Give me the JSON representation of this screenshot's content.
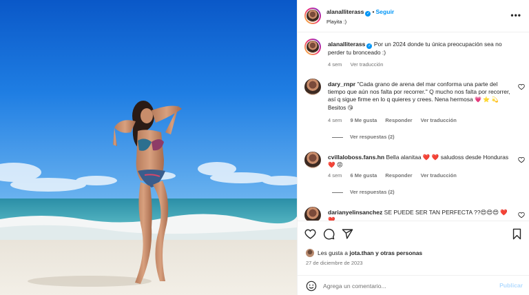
{
  "post": {
    "author": "alanalliterass",
    "location": "Playita :)",
    "follow_label": "Seguir",
    "caption_text": "Por un 2024 donde tu única preocupación sea no perder tu bronceado :)",
    "caption_age": "4 sem",
    "caption_translate": "Ver traducción"
  },
  "comments": [
    {
      "user": "dary_rnpr",
      "text": "\"Cada grano de arena del mar conforma una parte del tiempo que aún nos falta por recorrer.\" Q mucho nos falta por recorrer, así q sigue firme en lo q quieres y crees. Nena hermosa",
      "emoji_tail": "💗 ⭐ 💫 Besitos 😘",
      "age": "4 sem",
      "likes": "9 Me gusta",
      "reply": "Responder",
      "translate": "Ver traducción",
      "replies": "Ver respuestas (2)"
    },
    {
      "user": "cvillaloboss.fans.hn",
      "text": "Bella alanitaa ❤️ ❤️ saludoss desde Honduras ❤️ 😡",
      "age": "4 sem",
      "likes": "6 Me gusta",
      "reply": "Responder",
      "translate": "Ver traducción",
      "replies": "Ver respuestas (2)"
    },
    {
      "user": "darianyelinsanchez",
      "text": "SE PUEDE SER TAN PERFECTA ??😍😍😍 ❤️❤️"
    }
  ],
  "likes_line": {
    "prefix": "Les gusta a ",
    "user": "jota.than",
    "suffix": " y otras personas"
  },
  "date": "27 de diciembre de 2023",
  "composer": {
    "placeholder": "Agrega un comentario...",
    "publish": "Publicar"
  },
  "icons": [
    "more-options-icon",
    "verified-badge-icon",
    "heart-icon",
    "comment-icon",
    "share-icon",
    "save-icon",
    "emoji-icon"
  ],
  "colors": {
    "accent": "#0095f6",
    "muted": "#737373",
    "text": "#262626",
    "publish_disabled": "#b3dbff"
  }
}
